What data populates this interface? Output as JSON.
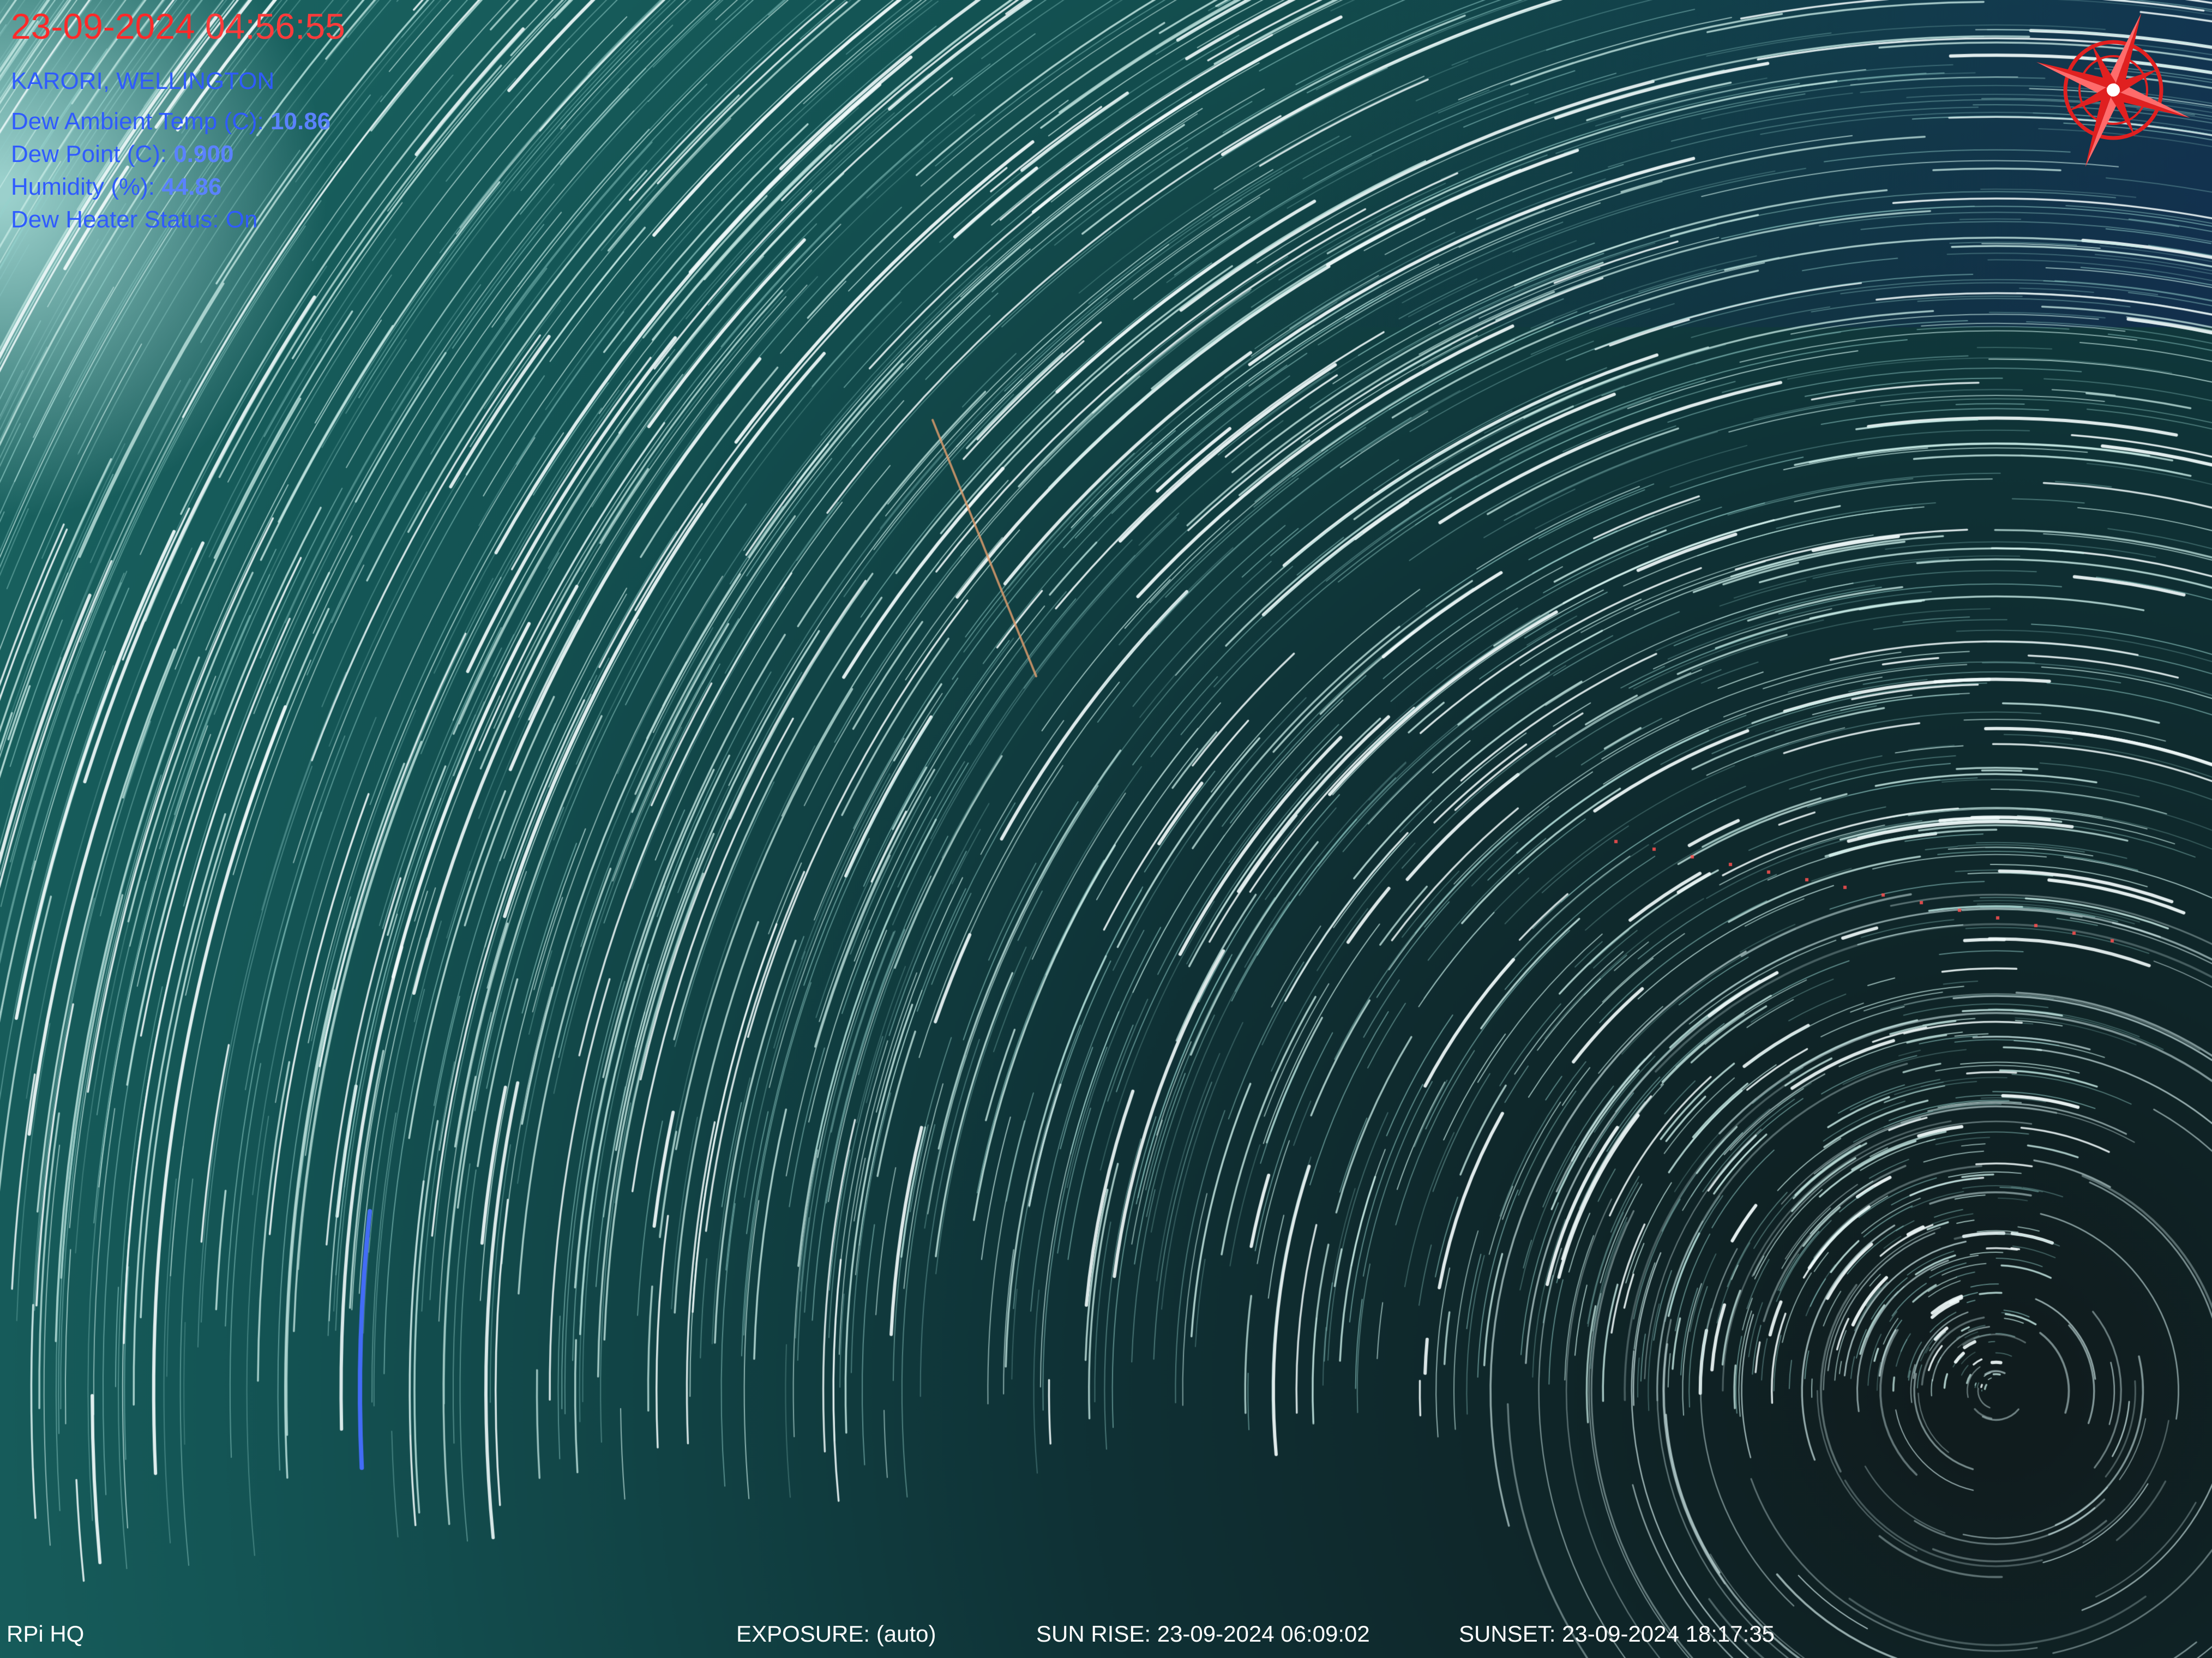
{
  "overlay": {
    "date": "23-09-2024",
    "time": "04:56:55",
    "location": "KARORI, WELLINGTON",
    "dew_ambient_temp": {
      "label": "Dew Ambient Temp (C):",
      "value": "10.86"
    },
    "dew_point": {
      "label": "Dew Point (C):",
      "value": "0.900"
    },
    "humidity": {
      "label": "Humidity (%):",
      "value": "44.86"
    },
    "dew_heater_status": {
      "label": "Dew Heater Status:",
      "value": "On"
    }
  },
  "footer": {
    "camera": "RPi HQ",
    "exposure": "EXPOSURE: (auto)",
    "sunrise": "SUN RISE: 23-09-2024 06:09:02",
    "sunset": "SUNSET: 23-09-2024 18:17:35"
  },
  "image": {
    "subject": "star trails around south celestial pole",
    "colors": {
      "sky": "#0f3b3c",
      "trail": "#e8f4f2",
      "overlay_red": "#ff2a2a",
      "overlay_blue": "#2f5bff",
      "footer_text": "#ffffff"
    }
  }
}
